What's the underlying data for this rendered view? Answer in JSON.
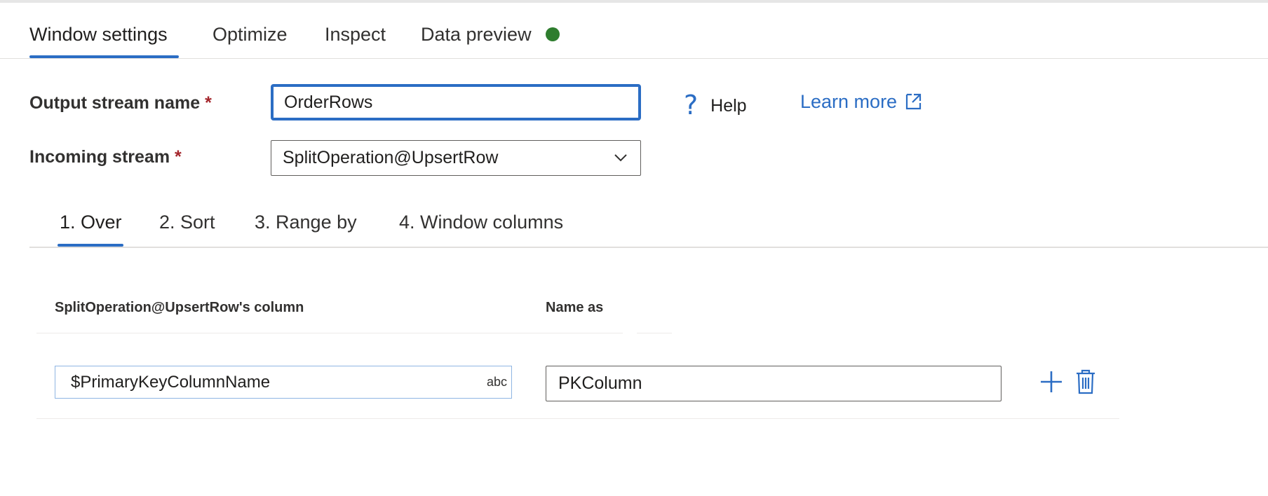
{
  "tabs": [
    {
      "label": "Window settings"
    },
    {
      "label": "Optimize"
    },
    {
      "label": "Inspect"
    },
    {
      "label": "Data preview"
    }
  ],
  "form": {
    "output_label": "Output stream name",
    "output_value": "OrderRows",
    "incoming_label": "Incoming stream",
    "incoming_value": "SplitOperation@UpsertRow",
    "required_marker": "*"
  },
  "help_label": "Help",
  "learn_more_label": "Learn more",
  "subtabs": [
    {
      "label": "1. Over"
    },
    {
      "label": "2. Sort"
    },
    {
      "label": "3. Range by"
    },
    {
      "label": "4. Window columns"
    }
  ],
  "grid": {
    "col1_header": "SplitOperation@UpsertRow's column",
    "col2_header": "Name as",
    "rows": [
      {
        "column": "$PrimaryKeyColumnName",
        "type_badge": "abc",
        "name_as": "PKColumn"
      }
    ]
  },
  "colors": {
    "accent": "#2b6dc4",
    "status_dot": "#2e7d2e",
    "required": "#a4262c"
  },
  "icons": [
    "help-icon",
    "external-link-icon",
    "chevron-down-icon",
    "add-icon",
    "delete-icon"
  ]
}
